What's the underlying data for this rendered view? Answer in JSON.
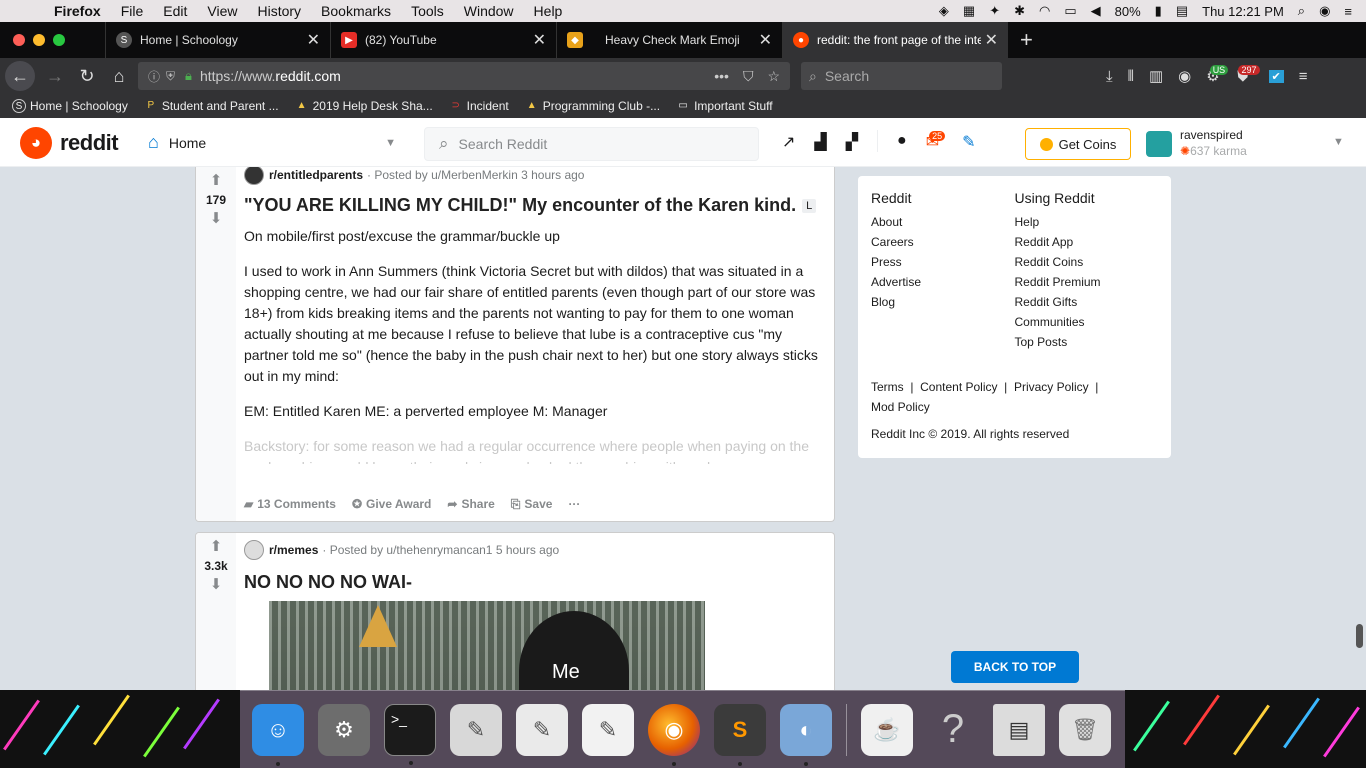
{
  "menubar": {
    "app": "Firefox",
    "items": [
      "File",
      "Edit",
      "View",
      "History",
      "Bookmarks",
      "Tools",
      "Window",
      "Help"
    ],
    "battery": "80%",
    "clock": "Thu 12:21 PM"
  },
  "tabs": [
    {
      "label": "Home | Schoology",
      "favicon": "S"
    },
    {
      "label": "(82) YouTube",
      "favicon": "▶"
    },
    {
      "label": "Heavy Check Mark Emoji",
      "favicon": "◆"
    },
    {
      "label": "reddit: the front page of the inte",
      "favicon": "●"
    }
  ],
  "nav": {
    "url_prefix": "https://www.",
    "url_domain": "reddit.com",
    "search_placeholder": "Search",
    "ext_badge_us": "US",
    "ext_badge_count": "297"
  },
  "bookmarks": [
    {
      "label": "Home | Schoology",
      "icon": "S"
    },
    {
      "label": "Student and Parent ...",
      "icon": "P"
    },
    {
      "label": "2019 Help Desk Sha...",
      "icon": "▲"
    },
    {
      "label": "Incident",
      "icon": "⊃"
    },
    {
      "label": "Programming Club -...",
      "icon": "▲"
    },
    {
      "label": "Important Stuff",
      "icon": "▭"
    }
  ],
  "reddit_header": {
    "logo_text": "reddit",
    "home_label": "Home",
    "search_placeholder": "Search Reddit",
    "mail_badge": "25",
    "get_coins": "Get Coins",
    "username": "ravenspired",
    "karma": "637 karma"
  },
  "posts": [
    {
      "score": "179",
      "subreddit": "r/entitledparents",
      "meta": "· Posted by u/MerbenMerkin 3 hours ago",
      "title": "\"YOU ARE KILLING MY CHILD!\" My encounter of the Karen kind.",
      "flair": "L",
      "paragraphs": [
        "On mobile/first post/excuse the grammar/buckle up",
        "I used to work in Ann Summers (think Victoria Secret but with dildos) that was situated in a shopping centre, we had our fair share of entitled parents (even though part of our store was 18+) from kids breaking items and the parents not wanting to pay for them to one woman actually shouting at me because I refuse to believe that lube is a contraceptive cus \"my partner told me so\" (hence the baby in the push chair next to her) but one story always sticks out in my mind:",
        "EM: Entitled Karen ME: a perverted employee M: Manager"
      ],
      "faded": "Backstory: for some reason we had a regular occurrence where people when paying on the card machine would leave their cards in, we checked the machine with each",
      "actions": {
        "comments": "13 Comments",
        "award": "Give Award",
        "share": "Share",
        "save": "Save",
        "more": "···"
      }
    },
    {
      "score": "3.3k",
      "subreddit": "r/memes",
      "meta": "· Posted by u/thehenrymancan1 5 hours ago",
      "title": "NO NO NO NO WAI-",
      "image_caption": "Me"
    }
  ],
  "sidebar": {
    "col1_heading": "Reddit",
    "col1": [
      "About",
      "Careers",
      "Press",
      "Advertise",
      "Blog"
    ],
    "col2_heading": "Using Reddit",
    "col2": [
      "Help",
      "Reddit App",
      "Reddit Coins",
      "Reddit Premium",
      "Reddit Gifts",
      "Communities",
      "Top Posts"
    ],
    "legal": [
      "Terms",
      "Content Policy",
      "Privacy Policy",
      "Mod Policy"
    ],
    "copyright": "Reddit Inc © 2019. All rights reserved"
  },
  "back_to_top": "BACK TO TOP",
  "dock": [
    {
      "name": "finder-icon",
      "color": "#2f8de4",
      "glyph": "☺"
    },
    {
      "name": "system-preferences-icon",
      "color": "#6d6d6d",
      "glyph": "⚙"
    },
    {
      "name": "terminal-icon",
      "color": "#1b1b1b",
      "glyph": ">_"
    },
    {
      "name": "script-editor-icon",
      "color": "#d8d8d8",
      "glyph": "✎"
    },
    {
      "name": "textedit-icon",
      "color": "#eaeaea",
      "glyph": "✎"
    },
    {
      "name": "notes-icon",
      "color": "#f2f2f2",
      "glyph": "✎"
    },
    {
      "name": "firefox-icon",
      "color": "#e66000",
      "glyph": "◉"
    },
    {
      "name": "sublime-text-icon",
      "color": "#3b3b3b",
      "glyph": "S"
    },
    {
      "name": "preview-icon",
      "color": "#7aa7d8",
      "glyph": "◐"
    },
    {
      "name": "jar-launcher-icon",
      "color": "#f0f0f0",
      "glyph": "☕"
    },
    {
      "name": "unknown-app-icon",
      "color": "transparent",
      "glyph": "?"
    },
    {
      "name": "screen-capture-icon",
      "color": "#dcdcdc",
      "glyph": "▤"
    },
    {
      "name": "trash-icon",
      "color": "#e0e0e0",
      "glyph": "🗑"
    }
  ],
  "colors": {
    "reddit_orange": "#ff4500",
    "reddit_blue": "#0079d3",
    "coin_gold": "#ffb000"
  }
}
